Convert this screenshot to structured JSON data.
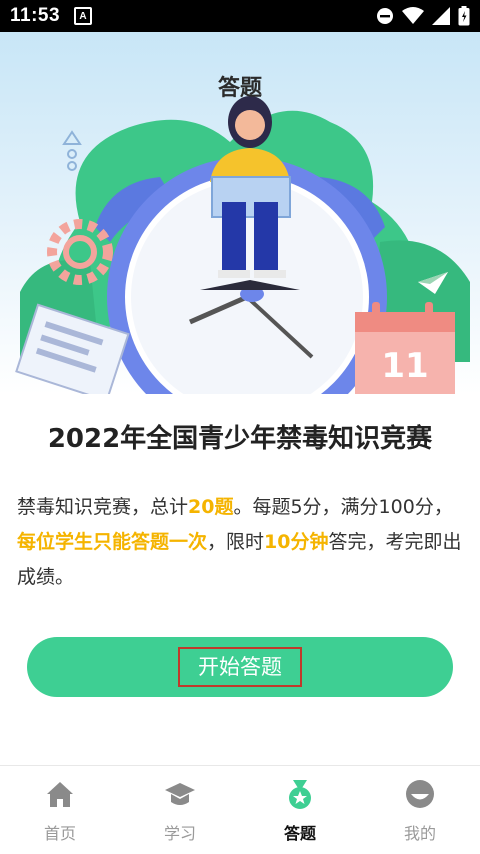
{
  "status_bar": {
    "time": "11:53",
    "notification_badge": "A"
  },
  "hero": {
    "title": "答题"
  },
  "quiz": {
    "headline": "2022年全国青少年禁毒知识竞赛",
    "desc_1": "禁毒知识竞赛，总计",
    "desc_hl_1": "20题",
    "desc_2": "。每题5分，满分100分，",
    "desc_hl_2": "每位学生只能答题一次",
    "desc_3": "，限时",
    "desc_hl_3": "10分钟",
    "desc_4": "答完，考完即出成绩。",
    "highlight_color": "#f5b400",
    "start_button": "开始答题",
    "button_color": "#3ecf93"
  },
  "tabs": [
    {
      "label": "首页",
      "icon": "home-icon"
    },
    {
      "label": "学习",
      "icon": "graduation-cap-icon"
    },
    {
      "label": "答题",
      "icon": "medal-icon",
      "active": true
    },
    {
      "label": "我的",
      "icon": "profile-icon"
    }
  ],
  "calendar_number": "11"
}
